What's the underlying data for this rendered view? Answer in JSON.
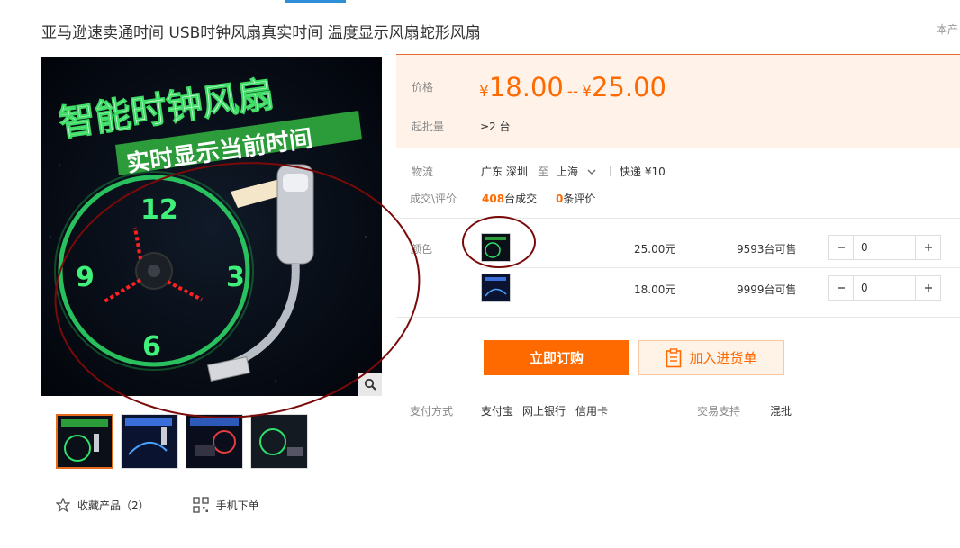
{
  "title": "亚马逊速卖通时间 USB时钟风扇真实时间 温度显示风扇蛇形风扇",
  "title_right": "本产",
  "main_image": {
    "headline": "智能时钟风扇",
    "banner": "实时显示当前时间",
    "clock_numbers": [
      "12",
      "3",
      "6",
      "9"
    ]
  },
  "price": {
    "label": "价格",
    "currency": "¥",
    "low": "18.00",
    "separator": "--",
    "high": "25.00"
  },
  "min_order": {
    "label": "起批量",
    "value": "≥2 台"
  },
  "logistics": {
    "label": "物流",
    "from": "广东 深圳",
    "to_word": "至",
    "to": "上海",
    "express": "快递 ¥10"
  },
  "deals": {
    "label": "成交\\评价",
    "sold_count": "408",
    "sold_text": "台成交",
    "review_count": "0",
    "review_text": "条评价"
  },
  "color_label": "颜色",
  "skus": [
    {
      "price": "25.00元",
      "stock_num": "9593",
      "stock_text": "台可售",
      "qty": "0"
    },
    {
      "price": "18.00元",
      "stock_num": "9999",
      "stock_text": "台可售",
      "qty": "0"
    }
  ],
  "buttons": {
    "buy": "立即订购",
    "cart": "加入进货单"
  },
  "payment": {
    "label": "支付方式",
    "methods": [
      "支付宝",
      "网上银行",
      "信用卡"
    ],
    "support_label": "交易支持",
    "support_value": "混批"
  },
  "actions": {
    "favorite": "收藏产品（2）",
    "mobile": "手机下单"
  },
  "colors": {
    "accent": "#ff6a00",
    "annotation": "#7a0a0a",
    "price_bg": "#fff2e8"
  }
}
